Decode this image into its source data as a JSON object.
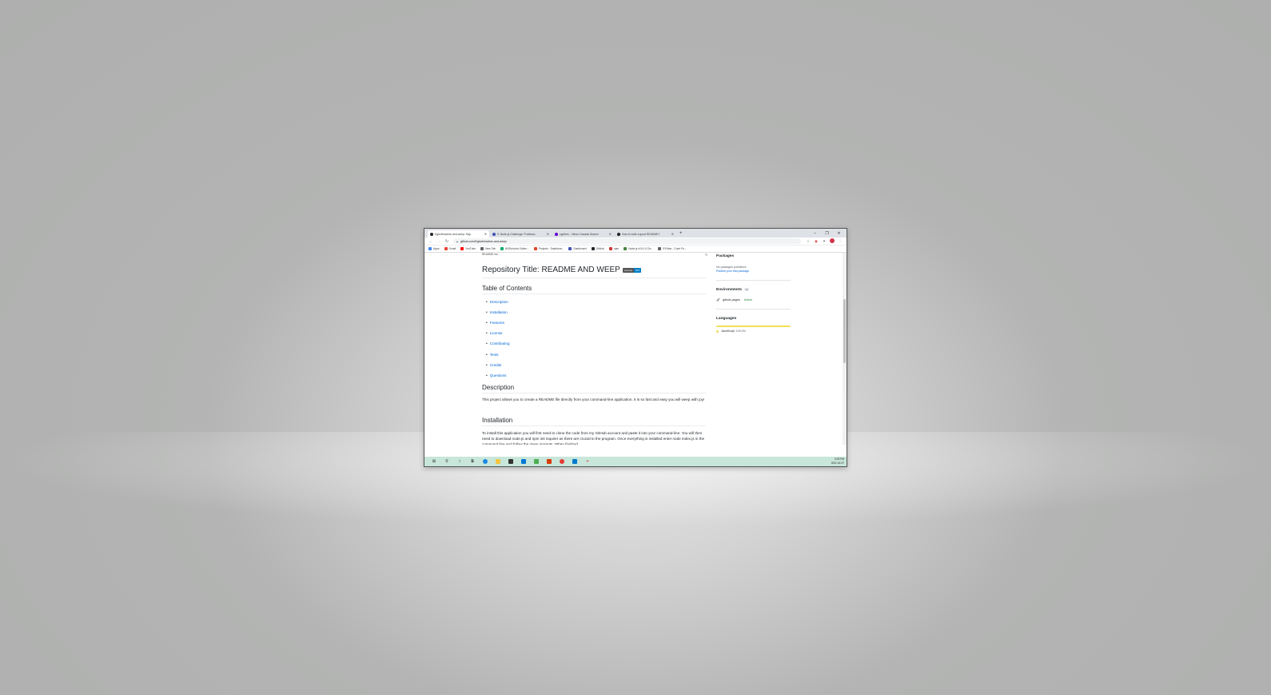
{
  "browser": {
    "tabs": [
      {
        "title": "Kgirzl/readme-and-weep: Hap",
        "active": true,
        "color": "#24292e"
      },
      {
        "title": "9: Node.js Challenge: Professio",
        "active": false,
        "color": "#3f51b5"
      },
      {
        "title": "cypthes - Yahoo Canada Search",
        "active": false,
        "color": "#6001d2"
      },
      {
        "title": "How to write a good README f",
        "active": false,
        "color": "#222222"
      }
    ],
    "new_tab": "+",
    "window_controls": {
      "minimize": "–",
      "maximize": "❐",
      "close": "✕"
    },
    "url": "github.com/Kgirzl/readme-and-weep",
    "bookmarks": [
      {
        "label": "Apps",
        "color": "#4285f4"
      },
      {
        "label": "Gmail",
        "color": "#ea4335"
      },
      {
        "label": "YouTube",
        "color": "#ff0000"
      },
      {
        "label": "New Tab",
        "color": "#5f6368"
      },
      {
        "label": "W3Schools Online...",
        "color": "#04aa6d"
      },
      {
        "label": "Projects · Dashboar...",
        "color": "#e24329"
      },
      {
        "label": "Dashboard",
        "color": "#3f51b5"
      },
      {
        "label": "GitHub",
        "color": "#24292e"
      },
      {
        "label": "npm",
        "color": "#cb3837"
      },
      {
        "label": "Node.js v15.1.0 Do...",
        "color": "#43853d"
      },
      {
        "label": "SYNtax - Code Fe...",
        "color": "#5f6368"
      }
    ]
  },
  "readme": {
    "crumb": "README.md",
    "title": "Repository Title: README AND WEEP",
    "badge": {
      "left": "License",
      "right": "MIT"
    },
    "toc_heading": "Table of Contents",
    "toc": [
      "Description",
      "Installation",
      "Features",
      "License",
      "Contributing",
      "Tests",
      "Credits",
      "Questions"
    ],
    "description_heading": "Description",
    "description": "This project allows you to create a README file directly from your command-line application. It is so fast and easy you will weep with joy!",
    "installation_heading": "Installation",
    "installation": "To install this application you will first need to clone the code from my GitHub account and paste it into your command-line. You will then need to download node.js and npm init inquirer as there are crucial to the program. Once everything is installed enter node index.js in the command line and follow the given prompts. When finished"
  },
  "sidebar": {
    "packages_heading": "Packages",
    "packages_text": "No packages published",
    "packages_link": "Publish your first package",
    "environments_heading": "Environments",
    "environments_count": "1",
    "env_name": "github-pages",
    "env_status": "Active",
    "languages_heading": "Languages",
    "language": "JavaScript",
    "language_pct": "100.0%"
  },
  "taskbar": {
    "time": "5:25 PM",
    "date": "2021-02-07"
  }
}
